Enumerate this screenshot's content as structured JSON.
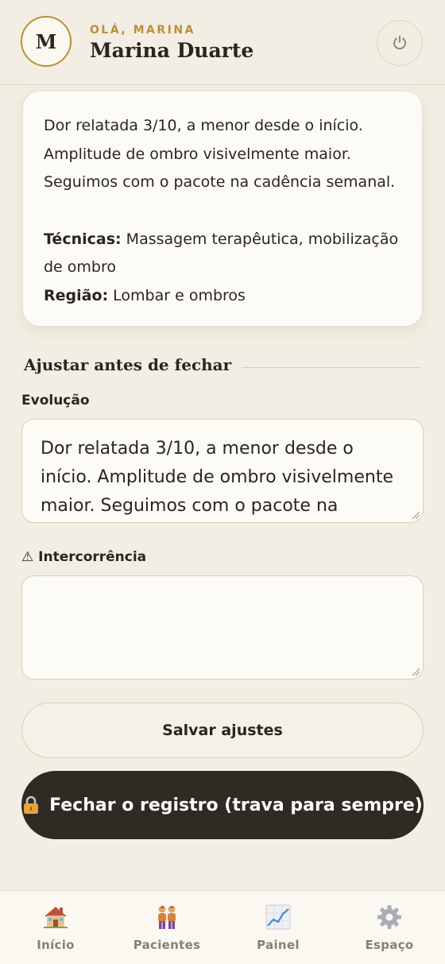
{
  "header": {
    "avatar_initial": "M",
    "greeting": "OLÁ, MARINA",
    "user_name": "Marina Duarte",
    "power_icon": "power-icon"
  },
  "note_card": {
    "evolution_lines": [
      "Dor relatada 3/10, a menor desde o início.",
      "Amplitude de ombro visivelmente maior.",
      "Seguimos com o pacote na cadência semanal."
    ],
    "techniques_label": "Técnicas:",
    "techniques_value": "Massagem terapêutica, mobilização de ombro",
    "region_label": "Região:",
    "region_value": "Lombar e ombros"
  },
  "adjust": {
    "section_title": "Ajustar antes de fechar",
    "evolution_label": "Evolução",
    "evolution_value": "Dor relatada 3/10, a menor desde o início. Amplitude de ombro visivelmente maior. Seguimos com o pacote na cadência semanal.",
    "incident_label": "⚠ Intercorrência",
    "incident_value": ""
  },
  "actions": {
    "save_label": "Salvar ajustes",
    "close_label": "Fechar o registro (trava para sempre)"
  },
  "bottom_nav": {
    "items": [
      {
        "label": "Início",
        "icon": "house-icon"
      },
      {
        "label": "Pacientes",
        "icon": "people-icon"
      },
      {
        "label": "Painel",
        "icon": "chart-icon"
      },
      {
        "label": "Espaço",
        "icon": "gear-icon"
      }
    ]
  },
  "colors": {
    "background": "#f3eee3",
    "accent_gold": "#b88f3a",
    "dark_button": "#2f2a24",
    "text": "#2b2520"
  }
}
